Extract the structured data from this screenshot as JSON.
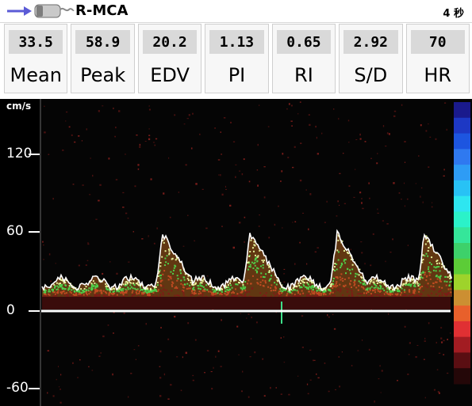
{
  "header": {
    "title": "R-MCA",
    "duration": "4 秒",
    "icons": [
      "arrow-right-icon",
      "ultrasound-probe-icon"
    ]
  },
  "metrics": [
    {
      "value": "33.5",
      "label": "Mean"
    },
    {
      "value": "58.9",
      "label": "Peak"
    },
    {
      "value": "20.2",
      "label": "EDV"
    },
    {
      "value": "1.13",
      "label": "PI"
    },
    {
      "value": "0.65",
      "label": "RI"
    },
    {
      "value": "2.92",
      "label": "S/D"
    },
    {
      "value": "70",
      "label": "HR"
    }
  ],
  "spectrum": {
    "unit": "cm/s",
    "yticks": [
      "120",
      "60",
      "0",
      "-60"
    ],
    "color_scale": [
      "#1a1a8c",
      "#1d38c4",
      "#1d55e0",
      "#2f79f0",
      "#2e9cf5",
      "#28c2f5",
      "#2ee6f0",
      "#2bf2c9",
      "#35e69a",
      "#3dd16a",
      "#5ccc37",
      "#9ed32b",
      "#cc8f32",
      "#e8602b",
      "#e03033",
      "#a21c22",
      "#5a0e12",
      "#240708"
    ]
  }
}
